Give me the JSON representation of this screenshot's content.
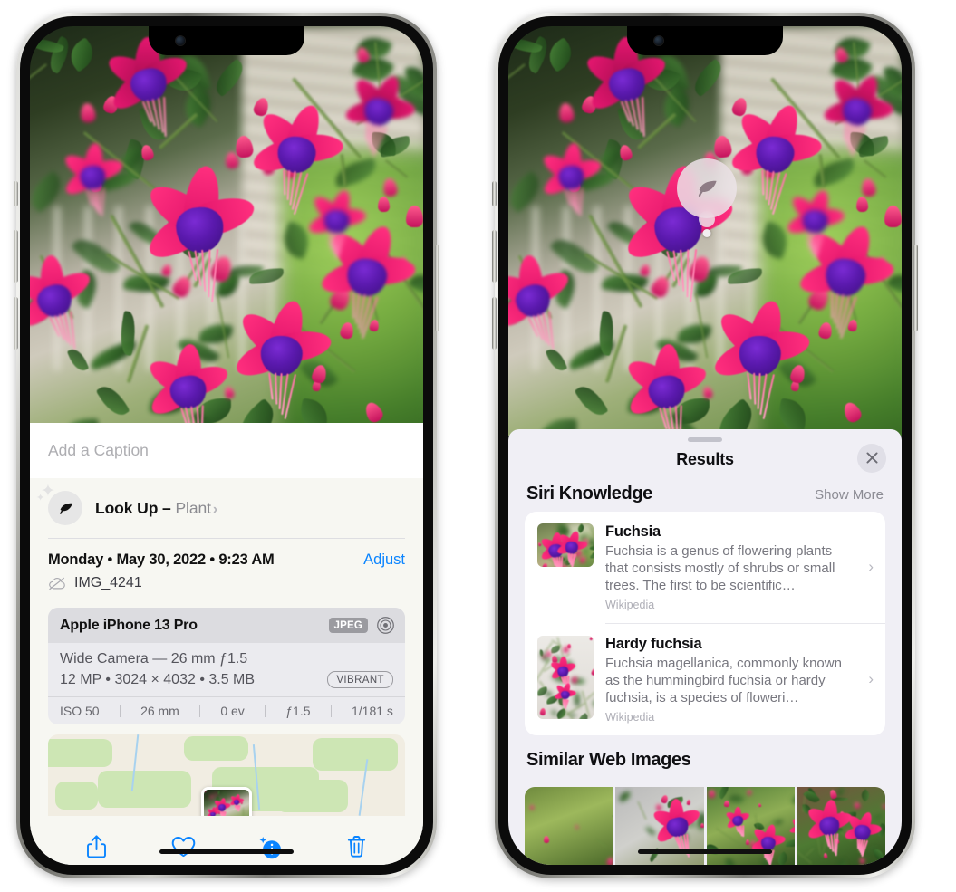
{
  "left_phone": {
    "photo": {
      "alt": "fuchsia-flowers-photo"
    },
    "caption": {
      "placeholder": "Add a Caption",
      "value": ""
    },
    "look_up": {
      "icon": "leaf-icon",
      "sparkle_icon": "sparkles-icon",
      "label": "Look Up – ",
      "subject": "Plant",
      "chevron": "›"
    },
    "metadata": {
      "date_line": "Monday • May 30, 2022 • 9:23 AM",
      "adjust_label": "Adjust",
      "cloud_icon": "cloud-slash-icon",
      "filename": "IMG_4241"
    },
    "camera_card": {
      "model": "Apple iPhone 13 Pro",
      "format_tag": "JPEG",
      "aperture_icon": "aperture-icon",
      "lens": "Wide Camera — 26 mm ƒ1.5",
      "size_line": "12 MP • 3024 × 4032 • 3.5 MB",
      "style_tag": "VIBRANT",
      "exif": [
        "ISO 50",
        "26 mm",
        "0 ev",
        "ƒ1.5",
        "1/181 s"
      ]
    },
    "map": {
      "thumb_alt": "photo-location-thumbnail"
    },
    "toolbar": [
      {
        "name": "share-icon",
        "label": "Share"
      },
      {
        "name": "heart-icon",
        "label": "Favorite"
      },
      {
        "name": "info-sparkle-icon",
        "label": "Info",
        "active": true
      },
      {
        "name": "trash-icon",
        "label": "Delete"
      }
    ]
  },
  "right_phone": {
    "photo": {
      "alt": "fuchsia-flowers-photo"
    },
    "leaf_pin": {
      "icon": "leaf-icon"
    },
    "sheet": {
      "title": "Results",
      "close_icon": "close-icon",
      "sections": [
        {
          "title": "Siri Knowledge",
          "action": "Show More",
          "items": [
            {
              "title": "Fuchsia",
              "description": "Fuchsia is a genus of flowering plants that consists mostly of shrubs or small trees. The first to be scientific…",
              "source": "Wikipedia",
              "chevron": "›",
              "thumb_alt": "fuchsia-thumbnail"
            },
            {
              "title": "Hardy fuchsia",
              "description": "Fuchsia magellanica, commonly known as the hummingbird fuchsia or hardy fuchsia, is a species of floweri…",
              "source": "Wikipedia",
              "chevron": "›",
              "thumb_alt": "hardy-fuchsia-thumbnail"
            }
          ]
        },
        {
          "title": "Similar Web Images",
          "images": [
            {
              "alt": "web-image-1"
            },
            {
              "alt": "web-image-2"
            },
            {
              "alt": "web-image-3"
            },
            {
              "alt": "web-image-4"
            }
          ]
        }
      ]
    }
  },
  "colors": {
    "accent_blue": "#0a84ff",
    "sheet_bg": "#f7f7f2",
    "results_bg": "#f0eff5",
    "card_bg": "#ffffff",
    "secondary_text": "#8b8b93"
  }
}
